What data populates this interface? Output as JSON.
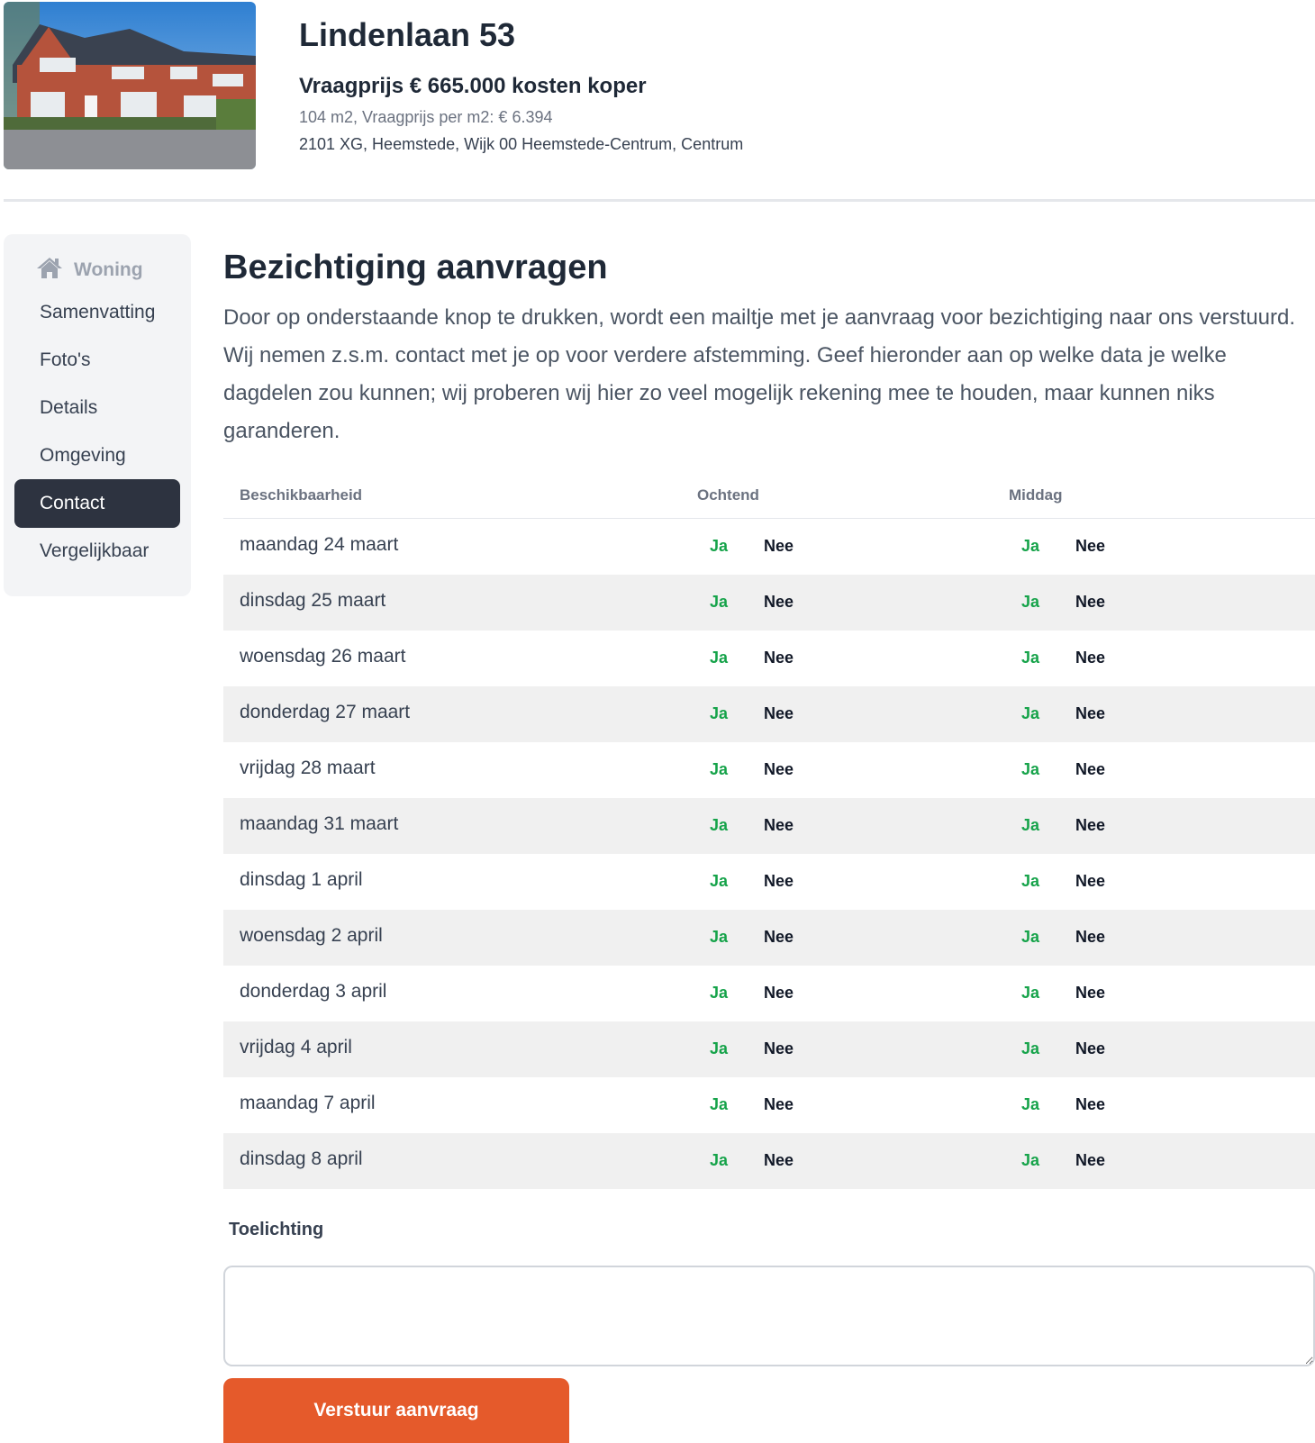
{
  "listing": {
    "title": "Lindenlaan 53",
    "price": "Vraagprijs € 665.000 kosten koper",
    "size_info": "104 m2, Vraagprijs per m2: € 6.394",
    "address": "2101 XG, Heemstede, Wijk 00 Heemstede-Centrum, Centrum"
  },
  "sidebar": {
    "heading": "Woning",
    "heading_icon": "home-icon",
    "items": [
      {
        "label": "Samenvatting",
        "active": false
      },
      {
        "label": "Foto's",
        "active": false
      },
      {
        "label": "Details",
        "active": false
      },
      {
        "label": "Omgeving",
        "active": false
      },
      {
        "label": "Contact",
        "active": true
      },
      {
        "label": "Vergelijkbaar",
        "active": false
      }
    ]
  },
  "main": {
    "title": "Bezichtiging aanvragen",
    "intro": "Door op onderstaande knop te drukken, wordt een mailtje met je aanvraag voor bezichtiging naar ons verstuurd. Wij nemen z.s.m. contact met je op voor verdere afstemming. Geef hieronder aan op welke data je welke dagdelen zou kunnen; wij proberen wij hier zo veel mogelijk rekening mee te houden, maar kunnen niks garanderen."
  },
  "availability": {
    "headers": {
      "availability": "Beschikbaarheid",
      "morning": "Ochtend",
      "afternoon": "Middag"
    },
    "yes_label": "Ja",
    "no_label": "Nee",
    "rows": [
      "maandag 24 maart",
      "dinsdag 25 maart",
      "woensdag 26 maart",
      "donderdag 27 maart",
      "vrijdag 28 maart",
      "maandag 31 maart",
      "dinsdag 1 april",
      "woensdag 2 april",
      "donderdag 3 april",
      "vrijdag 4 april",
      "maandag 7 april",
      "dinsdag 8 april"
    ]
  },
  "form": {
    "notes_label": "Toelichting",
    "notes_value": "",
    "submit_label": "Verstuur aanvraag"
  },
  "colors": {
    "accent": "#e55a2b",
    "active_nav": "#2d3340",
    "yes": "#16a34a"
  }
}
